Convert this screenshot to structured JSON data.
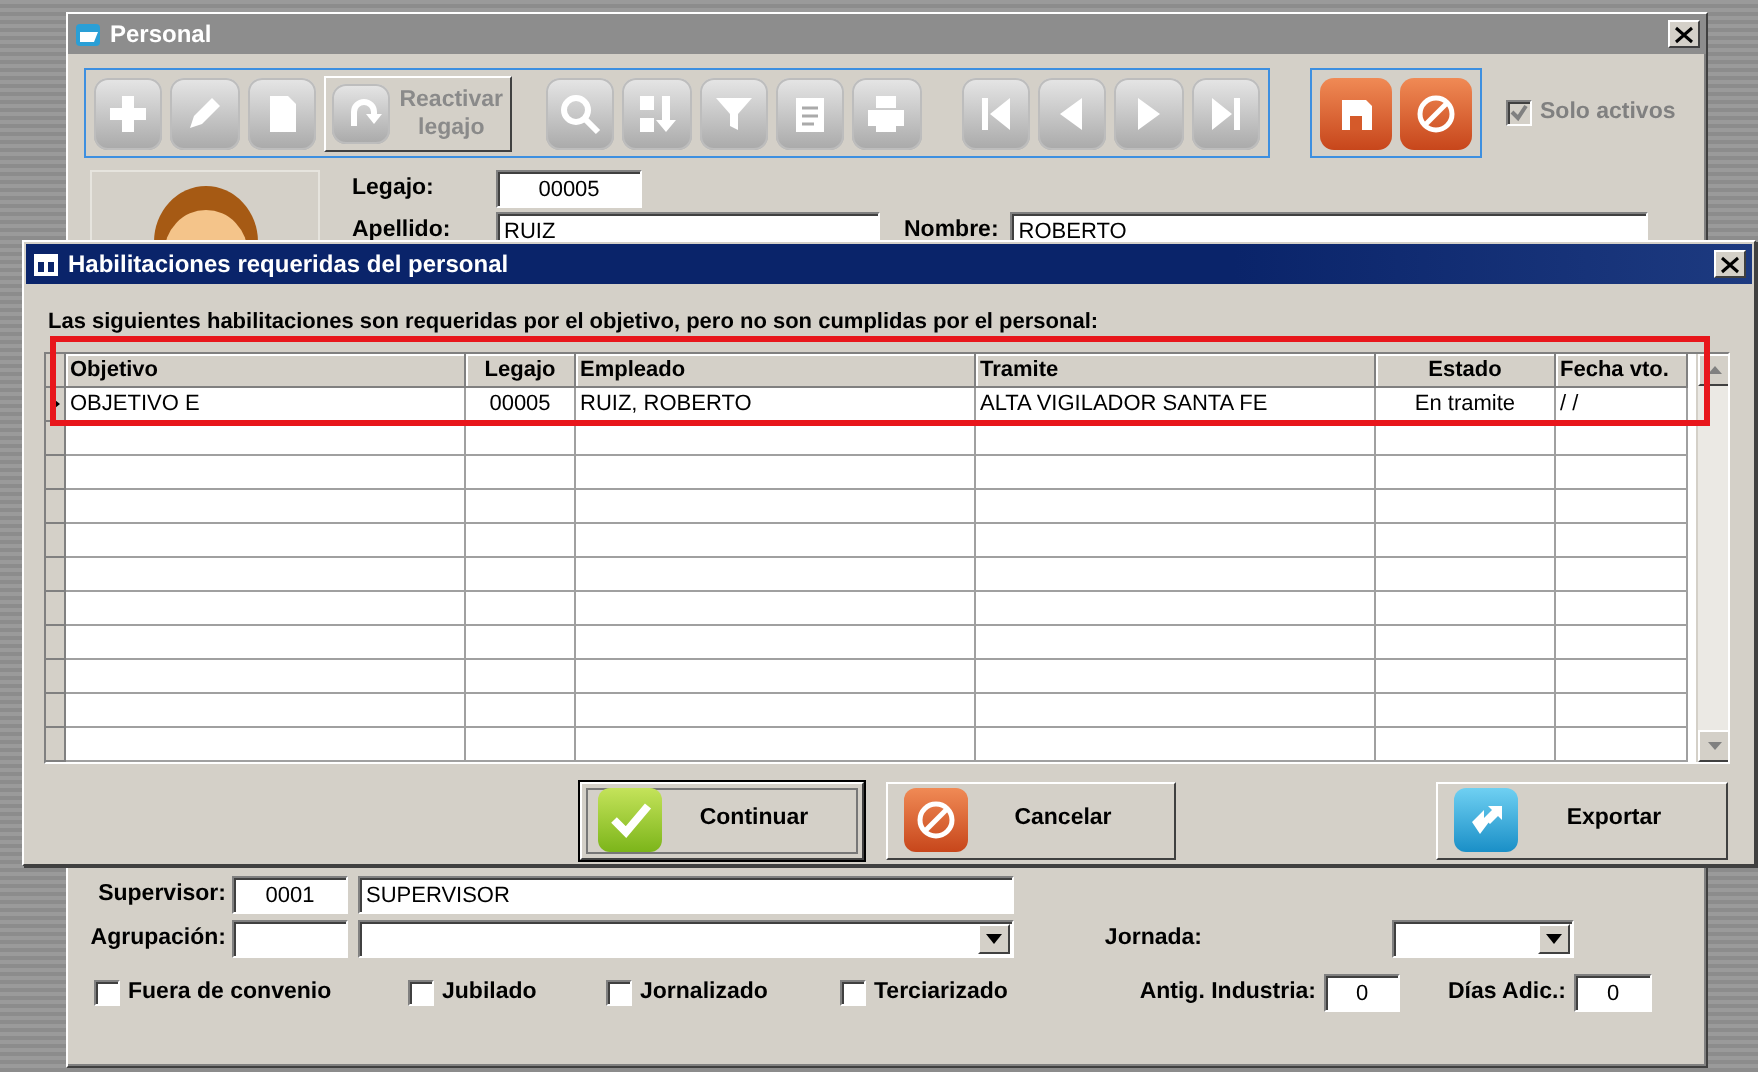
{
  "main_window": {
    "title": "Personal",
    "toolbar": [
      {
        "kind": "icon",
        "disabled": true
      },
      {
        "kind": "icon",
        "disabled": true
      },
      {
        "kind": "icon",
        "disabled": true
      },
      {
        "kind": "labeled",
        "label": "Reactivar legajo",
        "disabled": true
      },
      {
        "kind": "icon",
        "disabled": true
      },
      {
        "kind": "icon",
        "disabled": true
      },
      {
        "kind": "icon",
        "disabled": true
      },
      {
        "kind": "icon",
        "disabled": true
      },
      {
        "kind": "icon",
        "disabled": true
      },
      {
        "kind": "icon",
        "disabled": true
      },
      {
        "kind": "icon",
        "disabled": true
      },
      {
        "kind": "icon",
        "disabled": true
      },
      {
        "kind": "icon",
        "disabled": true
      }
    ],
    "actions": [
      {
        "kind": "save",
        "disabled": false
      },
      {
        "kind": "cancel",
        "disabled": false
      }
    ],
    "solo_activos": {
      "label": "Solo activos",
      "checked": true,
      "disabled": true
    },
    "legajo": {
      "label": "Legajo:",
      "value": "00005"
    },
    "apellido": {
      "label": "Apellido:",
      "value": "RUIZ"
    },
    "nombre": {
      "label": "Nombre:",
      "value": "ROBERTO"
    },
    "supervisor": {
      "label": "Supervisor:",
      "code": "0001",
      "value": "SUPERVISOR"
    },
    "agrupacion": {
      "label": "Agrupación:"
    },
    "jornada": {
      "label": "Jornada:"
    },
    "checkboxes": [
      {
        "label": "Fuera de convenio",
        "checked": false
      },
      {
        "label": "Jubilado",
        "checked": false
      },
      {
        "label": "Jornalizado",
        "checked": false
      },
      {
        "label": "Terciarizado",
        "checked": false
      }
    ],
    "antig_industria": {
      "label": "Antig. Industria:",
      "value": "0"
    },
    "dias_adic": {
      "label": "Días Adic.:",
      "value": "0"
    }
  },
  "dialog": {
    "title": "Habilitaciones requeridas del personal",
    "message": "Las siguientes habilitaciones son requeridas por el objetivo, pero no son cumplidas por el personal:",
    "table": {
      "columns": [
        "Objetivo",
        "Legajo",
        "Empleado",
        "Tramite",
        "Estado",
        "Fecha vto."
      ],
      "rows": [
        {
          "selected": true,
          "cells": [
            "OBJETIVO E",
            "00005",
            "RUIZ, ROBERTO",
            "ALTA VIGILADOR SANTA FE",
            "En tramite",
            "/ /"
          ]
        }
      ]
    },
    "buttons": [
      {
        "kind": "ok",
        "label": "Continuar",
        "focused": true
      },
      {
        "kind": "cancel",
        "label": "Cancelar",
        "focused": false
      },
      {
        "kind": "export",
        "label": "Exportar",
        "focused": false
      }
    ]
  }
}
